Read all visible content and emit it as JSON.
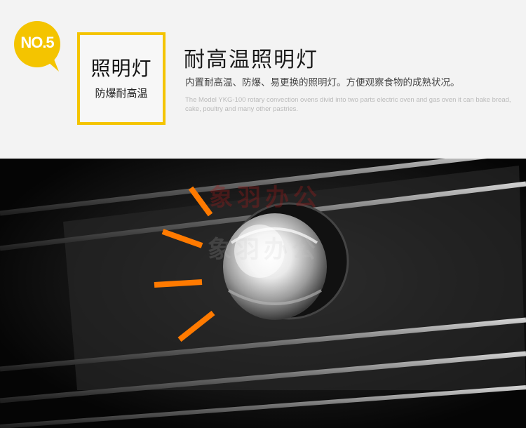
{
  "badge": {
    "label": "NO.5",
    "color": "#f4c400"
  },
  "feature": {
    "title": "照明灯",
    "subtitle": "防爆耐高温",
    "frame_color": "#f4c400"
  },
  "heading": "耐高温照明灯",
  "description": "内置耐高温、防爆、易更换的照明灯。方便观察食物的成熟状况。",
  "english_text": "The Model YKG-100 rotary convection ovens divid into two parts electric oven and gas oven it can bake bread, cake, poultry and many other pastries.",
  "photo": {
    "watermark": "象羽办公",
    "watermark_echo": "象羽办公",
    "accent_color": "#ff7a00",
    "icon": "oven-lamp-photo"
  }
}
